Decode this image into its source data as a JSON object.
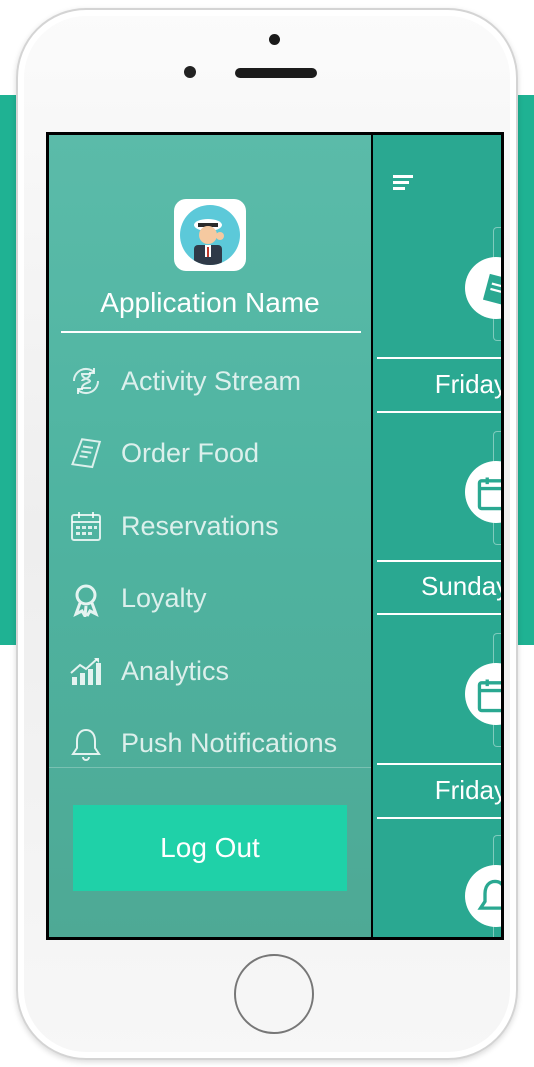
{
  "app": {
    "name": "Application Name"
  },
  "menu": {
    "items": [
      {
        "label": "Activity Stream",
        "icon": "hourglass-cycle-icon"
      },
      {
        "label": "Order Food",
        "icon": "receipt-icon"
      },
      {
        "label": "Reservations",
        "icon": "calendar-icon"
      },
      {
        "label": "Loyalty",
        "icon": "award-ribbon-icon"
      },
      {
        "label": "Analytics",
        "icon": "bar-chart-trend-icon"
      },
      {
        "label": "Push Notifications",
        "icon": "bell-icon"
      }
    ]
  },
  "logout": {
    "label": "Log Out"
  },
  "feed": {
    "days": [
      "Friday",
      "Sunday",
      "Friday"
    ]
  },
  "colors": {
    "background_band": "#1fb293",
    "drawer": "#4fb4a1",
    "content": "#2aa891",
    "logout_button": "#1fd1a8"
  }
}
